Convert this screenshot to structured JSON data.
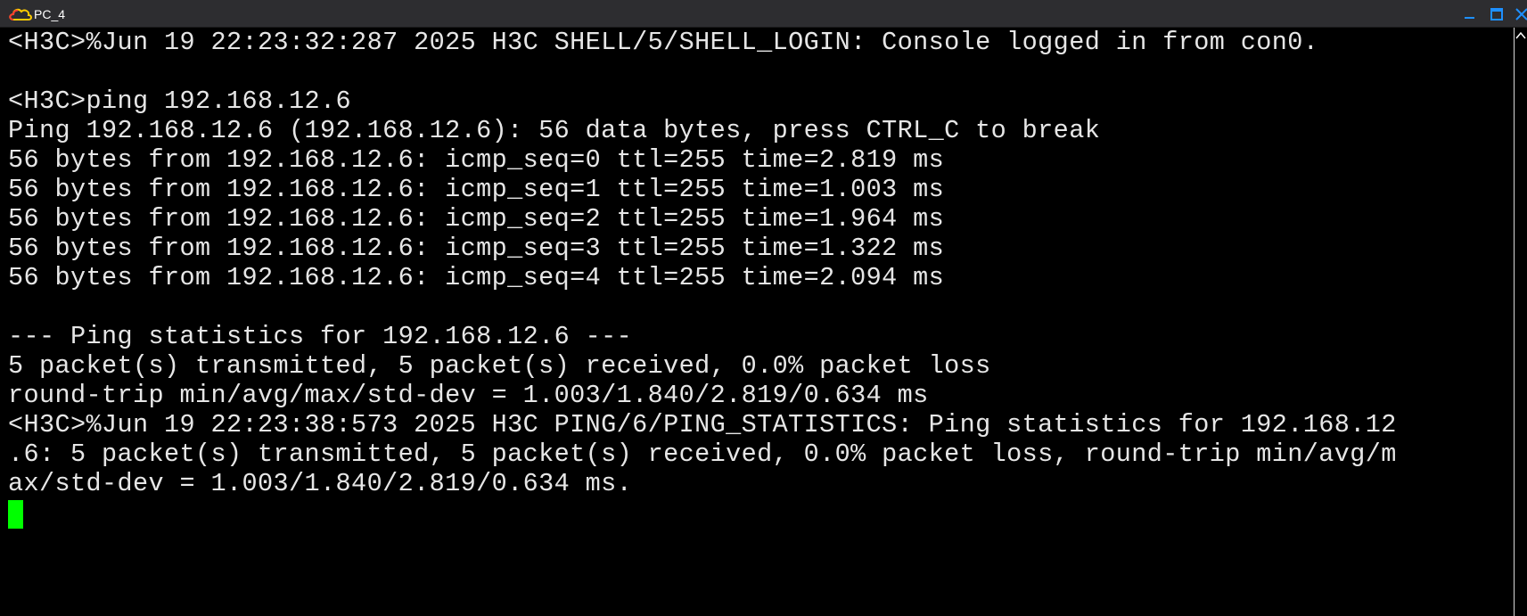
{
  "window": {
    "title": "PC_4",
    "icons": {
      "app": "cloud-icon",
      "minimize": "minimize-icon",
      "maximize": "maximize-icon",
      "close": "close-icon"
    }
  },
  "colors": {
    "titlebar_bg": "#2d2d30",
    "terminal_bg": "#000000",
    "terminal_fg": "#e6e6e6",
    "cursor": "#00ff00",
    "window_controls": "#1e90ff"
  },
  "terminal": {
    "lines": [
      "<H3C>%Jun 19 22:23:32:287 2025 H3C SHELL/5/SHELL_LOGIN: Console logged in from con0.",
      "",
      "<H3C>ping 192.168.12.6",
      "Ping 192.168.12.6 (192.168.12.6): 56 data bytes, press CTRL_C to break",
      "56 bytes from 192.168.12.6: icmp_seq=0 ttl=255 time=2.819 ms",
      "56 bytes from 192.168.12.6: icmp_seq=1 ttl=255 time=1.003 ms",
      "56 bytes from 192.168.12.6: icmp_seq=2 ttl=255 time=1.964 ms",
      "56 bytes from 192.168.12.6: icmp_seq=3 ttl=255 time=1.322 ms",
      "56 bytes from 192.168.12.6: icmp_seq=4 ttl=255 time=2.094 ms",
      "",
      "--- Ping statistics for 192.168.12.6 ---",
      "5 packet(s) transmitted, 5 packet(s) received, 0.0% packet loss",
      "round-trip min/avg/max/std-dev = 1.003/1.840/2.819/0.634 ms",
      "<H3C>%Jun 19 22:23:38:573 2025 H3C PING/6/PING_STATISTICS: Ping statistics for 192.168.12",
      ".6: 5 packet(s) transmitted, 5 packet(s) received, 0.0% packet loss, round-trip min/avg/m",
      "ax/std-dev = 1.003/1.840/2.819/0.634 ms."
    ]
  }
}
